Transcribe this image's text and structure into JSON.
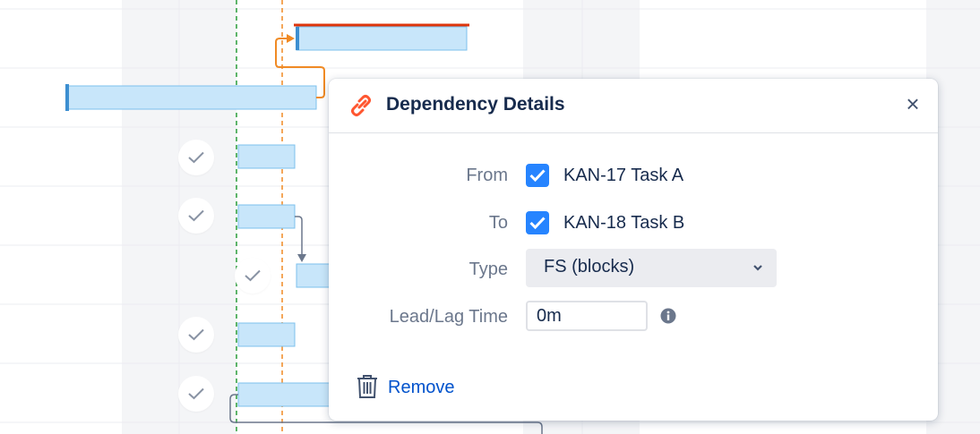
{
  "dialog": {
    "title": "Dependency Details",
    "close_glyph": "×",
    "from_label": "From",
    "from_value": "KAN-17 Task A",
    "from_checked": true,
    "to_label": "To",
    "to_value": "KAN-18 Task B",
    "to_checked": true,
    "type_label": "Type",
    "type_value": "FS (blocks)",
    "lag_label": "Lead/Lag Time",
    "lag_value": "0m",
    "remove_label": "Remove"
  },
  "icons": {
    "title": "link-icon",
    "close": "close-icon",
    "checkbox": "checkmark-icon",
    "type_dropdown": "chevron-down-icon",
    "lag_info": "info-icon",
    "remove": "trash-icon",
    "task_done": "check-icon"
  },
  "colors": {
    "accent": "#2684ff",
    "link": "#0052cc",
    "link_icon": "#ff5630",
    "task_bar_fill": "#c8e6fa",
    "task_bar_border": "#7cc0ec",
    "task_bar_start": "#3d8fd1",
    "critical_path": "#de350b",
    "today_marker": "#2a9d3a",
    "date_marker": "#f08a24",
    "dependency_arrow": "#6b778c",
    "weekend_column": "#f4f5f7",
    "row_divider": "#ebecf0"
  }
}
